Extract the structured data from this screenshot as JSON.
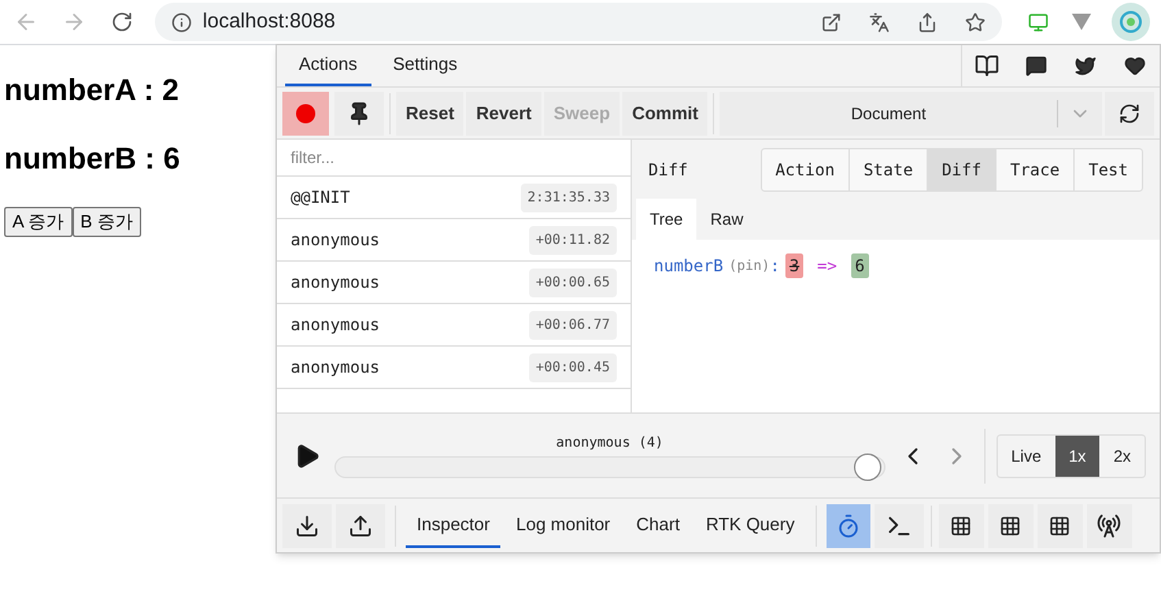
{
  "browser": {
    "address": "localhost:8088"
  },
  "page": {
    "headings": [
      "numberA : 2",
      "numberB : 6"
    ],
    "buttons": [
      "A 증가",
      "B 증가"
    ]
  },
  "devtools": {
    "tabs": [
      {
        "label": "Actions",
        "selected": true
      },
      {
        "label": "Settings",
        "selected": false
      }
    ],
    "toolbar": [
      {
        "label": "Reset",
        "disabled": false
      },
      {
        "label": "Revert",
        "disabled": false
      },
      {
        "label": "Sweep",
        "disabled": true
      },
      {
        "label": "Commit",
        "disabled": false
      }
    ],
    "instance": "Document",
    "filter": {
      "placeholder": "filter..."
    },
    "actions": [
      {
        "name": "@@INIT",
        "time": "2:31:35.33"
      },
      {
        "name": "anonymous",
        "time": "+00:11.82"
      },
      {
        "name": "anonymous",
        "time": "+00:00.65"
      },
      {
        "name": "anonymous",
        "time": "+00:06.77"
      },
      {
        "name": "anonymous",
        "time": "+00:00.45"
      }
    ],
    "panel_title": "Diff",
    "view_tabs": [
      {
        "label": "Action",
        "selected": false
      },
      {
        "label": "State",
        "selected": false
      },
      {
        "label": "Diff",
        "selected": true
      },
      {
        "label": "Trace",
        "selected": false
      },
      {
        "label": "Test",
        "selected": false
      }
    ],
    "sub_tabs": [
      {
        "label": "Tree",
        "selected": true
      },
      {
        "label": "Raw",
        "selected": false
      }
    ],
    "diff": {
      "key": "numberB",
      "hint": "(pin)",
      "colon": ":",
      "old": "3",
      "arrow": "=>",
      "new": "6"
    },
    "slider": {
      "label": "anonymous (4)",
      "level": 0.98
    },
    "speed": [
      {
        "label": "Live",
        "selected": false
      },
      {
        "label": "1x",
        "selected": true
      },
      {
        "label": "2x",
        "selected": false
      }
    ],
    "monitors": [
      {
        "label": "Inspector",
        "selected": true
      },
      {
        "label": "Log monitor",
        "selected": false
      },
      {
        "label": "Chart",
        "selected": false
      },
      {
        "label": "RTK Query",
        "selected": false
      }
    ]
  }
}
